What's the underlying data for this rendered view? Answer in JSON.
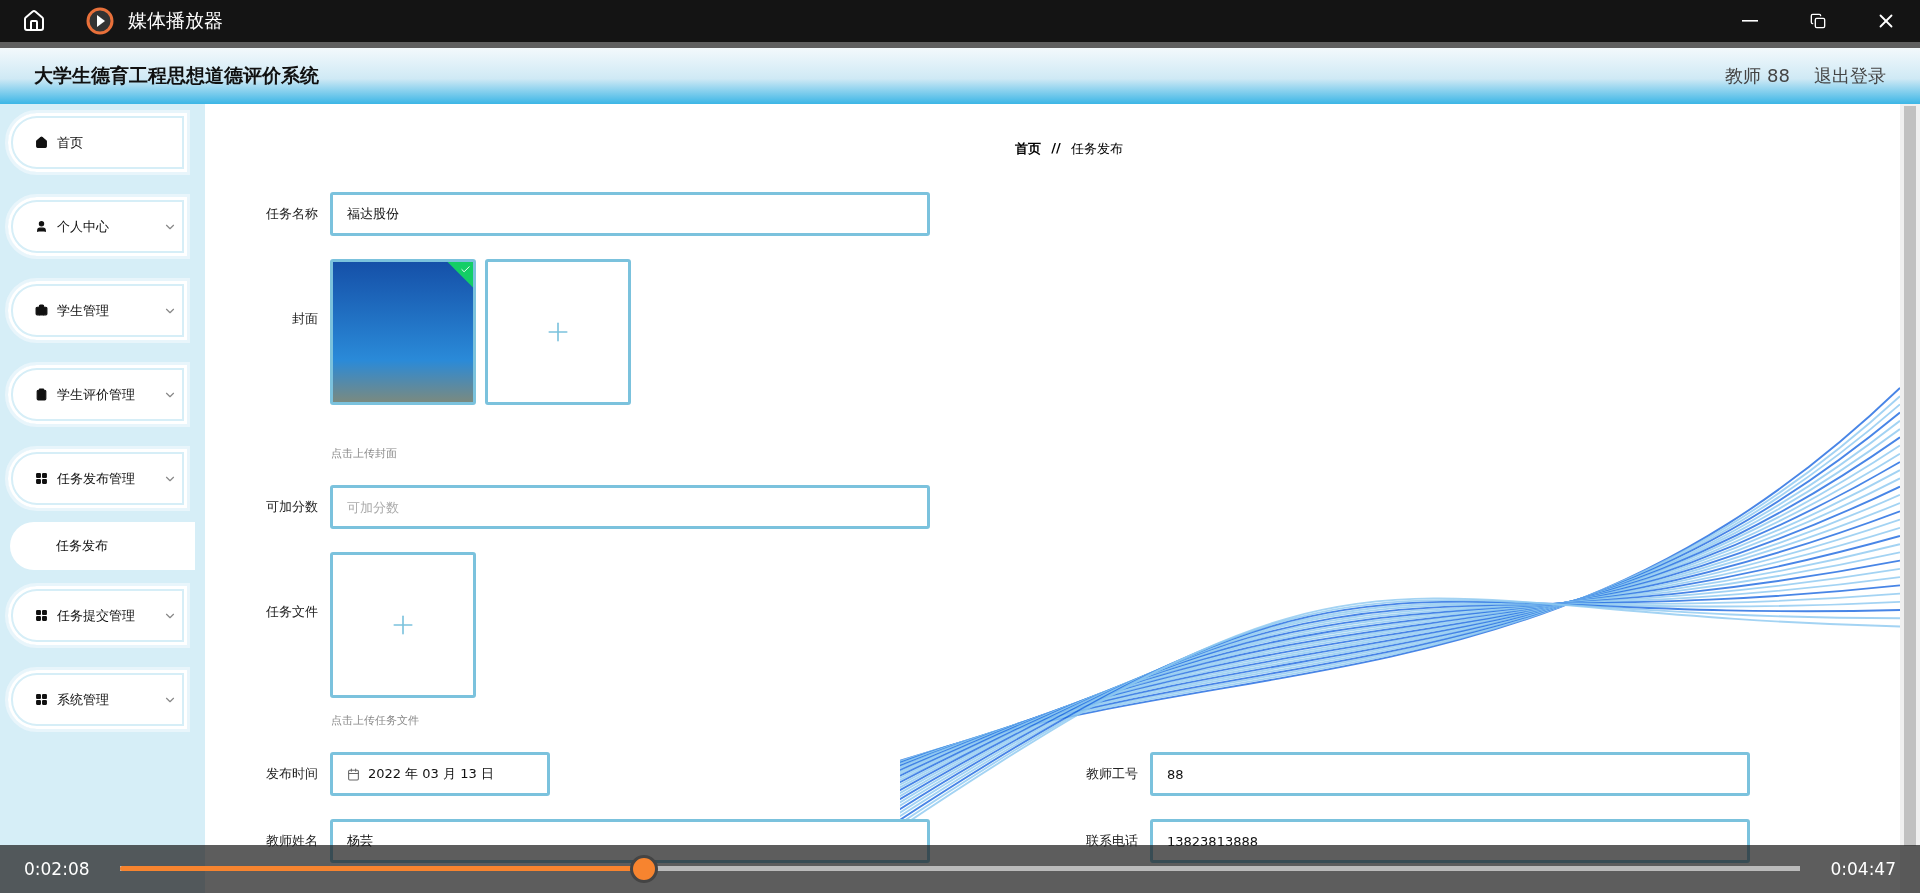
{
  "player": {
    "title": "媒体播放器",
    "elapsed": "0:02:08",
    "total": "0:04:47",
    "level": 0.312
  },
  "header": {
    "title": "大学生德育工程思想道德评价系统",
    "user": "教师 88",
    "logout": "退出登录"
  },
  "sidebar": {
    "items": [
      {
        "label": "首页",
        "kind": "link"
      },
      {
        "label": "个人中心",
        "kind": "menu"
      },
      {
        "label": "学生管理",
        "kind": "menu"
      },
      {
        "label": "学生评价管理",
        "kind": "menu"
      },
      {
        "label": "任务发布管理",
        "kind": "menu",
        "children": [
          {
            "label": "任务发布",
            "selected": true
          }
        ]
      },
      {
        "label": "任务提交管理",
        "kind": "menu"
      },
      {
        "label": "系统管理",
        "kind": "menu"
      }
    ]
  },
  "breadcrumb": {
    "home": "首页",
    "separator": "//",
    "current": "任务发布"
  },
  "form": {
    "task_name": {
      "label": "任务名称",
      "value": "福达股份"
    },
    "cover": {
      "label": "封面",
      "uploaded": true,
      "hint": "点击上传封面"
    },
    "score": {
      "label": "可加分数",
      "placeholder": "可加分数"
    },
    "file": {
      "label": "任务文件",
      "hint": "点击上传任务文件"
    },
    "rows": [
      [
        {
          "label": "发布时间",
          "value": "2022 年 03 月 13 日",
          "kind": "date"
        },
        {
          "label": "教师工号",
          "value": "88",
          "kind": "text"
        }
      ],
      [
        {
          "label": "教师姓名",
          "value": "杨芸",
          "kind": "text"
        },
        {
          "label": "联系电话",
          "value": "13823813888",
          "kind": "text"
        }
      ]
    ]
  }
}
